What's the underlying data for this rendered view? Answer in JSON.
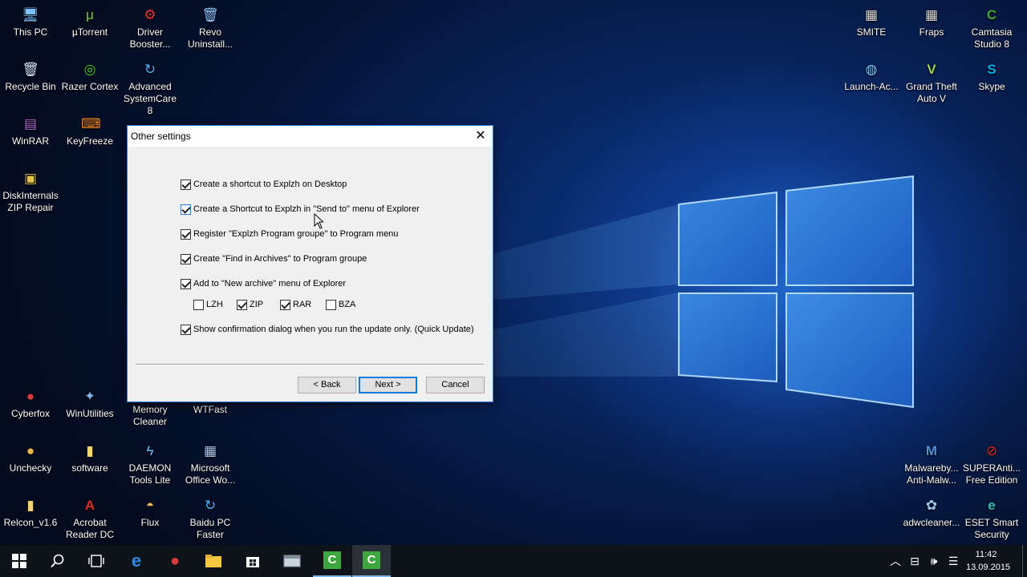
{
  "desktop": {
    "icons_left": [
      {
        "label": "This PC",
        "icon": "computer-icon",
        "glyph": "🖥"
      },
      {
        "label": "µTorrent",
        "icon": "utorrent-icon",
        "glyph": "μ"
      },
      {
        "label": "Driver Booster...",
        "icon": "driver-booster-icon",
        "glyph": "⚙"
      },
      {
        "label": "Revo Uninstall...",
        "icon": "revo-uninstaller-icon",
        "glyph": "🗑"
      },
      {
        "label": "Recycle Bin",
        "icon": "recycle-bin-icon",
        "glyph": "🗑"
      },
      {
        "label": "Razer Cortex",
        "icon": "razer-cortex-icon",
        "glyph": "◎"
      },
      {
        "label": "Advanced SystemCare 8",
        "icon": "advanced-systemcare-icon",
        "glyph": "↻"
      },
      {
        "label": "WinRAR",
        "icon": "winrar-icon",
        "glyph": "▤"
      },
      {
        "label": "KeyFreeze",
        "icon": "keyfreeze-icon",
        "glyph": "⌨"
      },
      {
        "label": "DiskInternals ZIP Repair",
        "icon": "zip-repair-icon",
        "glyph": "▣"
      },
      {
        "label": "Cyberfox",
        "icon": "cyberfox-icon",
        "glyph": "●"
      },
      {
        "label": "WinUtilities",
        "icon": "winutilities-icon",
        "glyph": "✦"
      },
      {
        "label": "Memory Cleaner",
        "icon": "memory-cleaner-icon",
        "glyph": ""
      },
      {
        "label": "WTFast",
        "icon": "wtfast-icon",
        "glyph": ""
      },
      {
        "label": "Unchecky",
        "icon": "unchecky-icon",
        "glyph": "●"
      },
      {
        "label": "software",
        "icon": "folder-icon",
        "glyph": "▮"
      },
      {
        "label": "DAEMON Tools Lite",
        "icon": "daemon-tools-icon",
        "glyph": "ϟ"
      },
      {
        "label": "Microsoft Office Wo...",
        "icon": "office-word-icon",
        "glyph": "▦"
      },
      {
        "label": "Relcon_v1.6",
        "icon": "relcon-icon",
        "glyph": "▮"
      },
      {
        "label": "Acrobat Reader DC",
        "icon": "acrobat-reader-icon",
        "glyph": "A"
      },
      {
        "label": "Flux",
        "icon": "flux-icon",
        "glyph": "◓"
      },
      {
        "label": "Baidu PC Faster",
        "icon": "baidu-pc-faster-icon",
        "glyph": "↻"
      }
    ],
    "icons_right": [
      {
        "label": "SMITE",
        "icon": "smite-icon",
        "glyph": "▦"
      },
      {
        "label": "Fraps",
        "icon": "fraps-icon",
        "glyph": "▦"
      },
      {
        "label": "Camtasia Studio 8",
        "icon": "camtasia-icon",
        "glyph": "C"
      },
      {
        "label": "Launch-Ac...",
        "icon": "launch-icon",
        "glyph": "◍"
      },
      {
        "label": "Grand Theft Auto V",
        "icon": "gta-icon",
        "glyph": "V"
      },
      {
        "label": "Skype",
        "icon": "skype-icon",
        "glyph": "S"
      },
      {
        "label": "Malwareby... Anti-Malw...",
        "icon": "malwarebytes-icon",
        "glyph": "M"
      },
      {
        "label": "SUPERAnti... Free Edition",
        "icon": "superantispyware-icon",
        "glyph": "⊘"
      },
      {
        "label": "adwcleaner...",
        "icon": "adwcleaner-icon",
        "glyph": "✿"
      },
      {
        "label": "ESET Smart Security",
        "icon": "eset-icon",
        "glyph": "e"
      }
    ]
  },
  "dialog": {
    "title": "Other settings",
    "close_glyph": "✕",
    "options": [
      {
        "label": "Create a shortcut to Explzh on Desktop",
        "checked": true
      },
      {
        "label": "Create a Shortcut to Explzh in \"Send to\" menu of Explorer",
        "checked": true
      },
      {
        "label": "Register \"Explzh Program groupe\" to Program menu",
        "checked": true
      },
      {
        "label": "Create \"Find in Archives\" to Program groupe",
        "checked": true
      },
      {
        "label": "Add to \"New archive\" menu of Explorer",
        "checked": true
      }
    ],
    "formats": [
      {
        "label": "LZH",
        "checked": false
      },
      {
        "label": "ZIP",
        "checked": true
      },
      {
        "label": "RAR",
        "checked": true
      },
      {
        "label": "BZA",
        "checked": false
      }
    ],
    "quick_update": {
      "label": "Show confirmation dialog when you run the update only. (Quick Update)",
      "checked": true
    },
    "buttons": {
      "back": "< Back",
      "next": "Next >",
      "cancel": "Cancel"
    }
  },
  "taskbar": {
    "clock_time": "11:42",
    "clock_date": "13.09.2015"
  },
  "colors": {
    "accent": "#0078d7",
    "dialog_bg": "#f0f0f0",
    "taskbar_bg": "#0e1319"
  }
}
